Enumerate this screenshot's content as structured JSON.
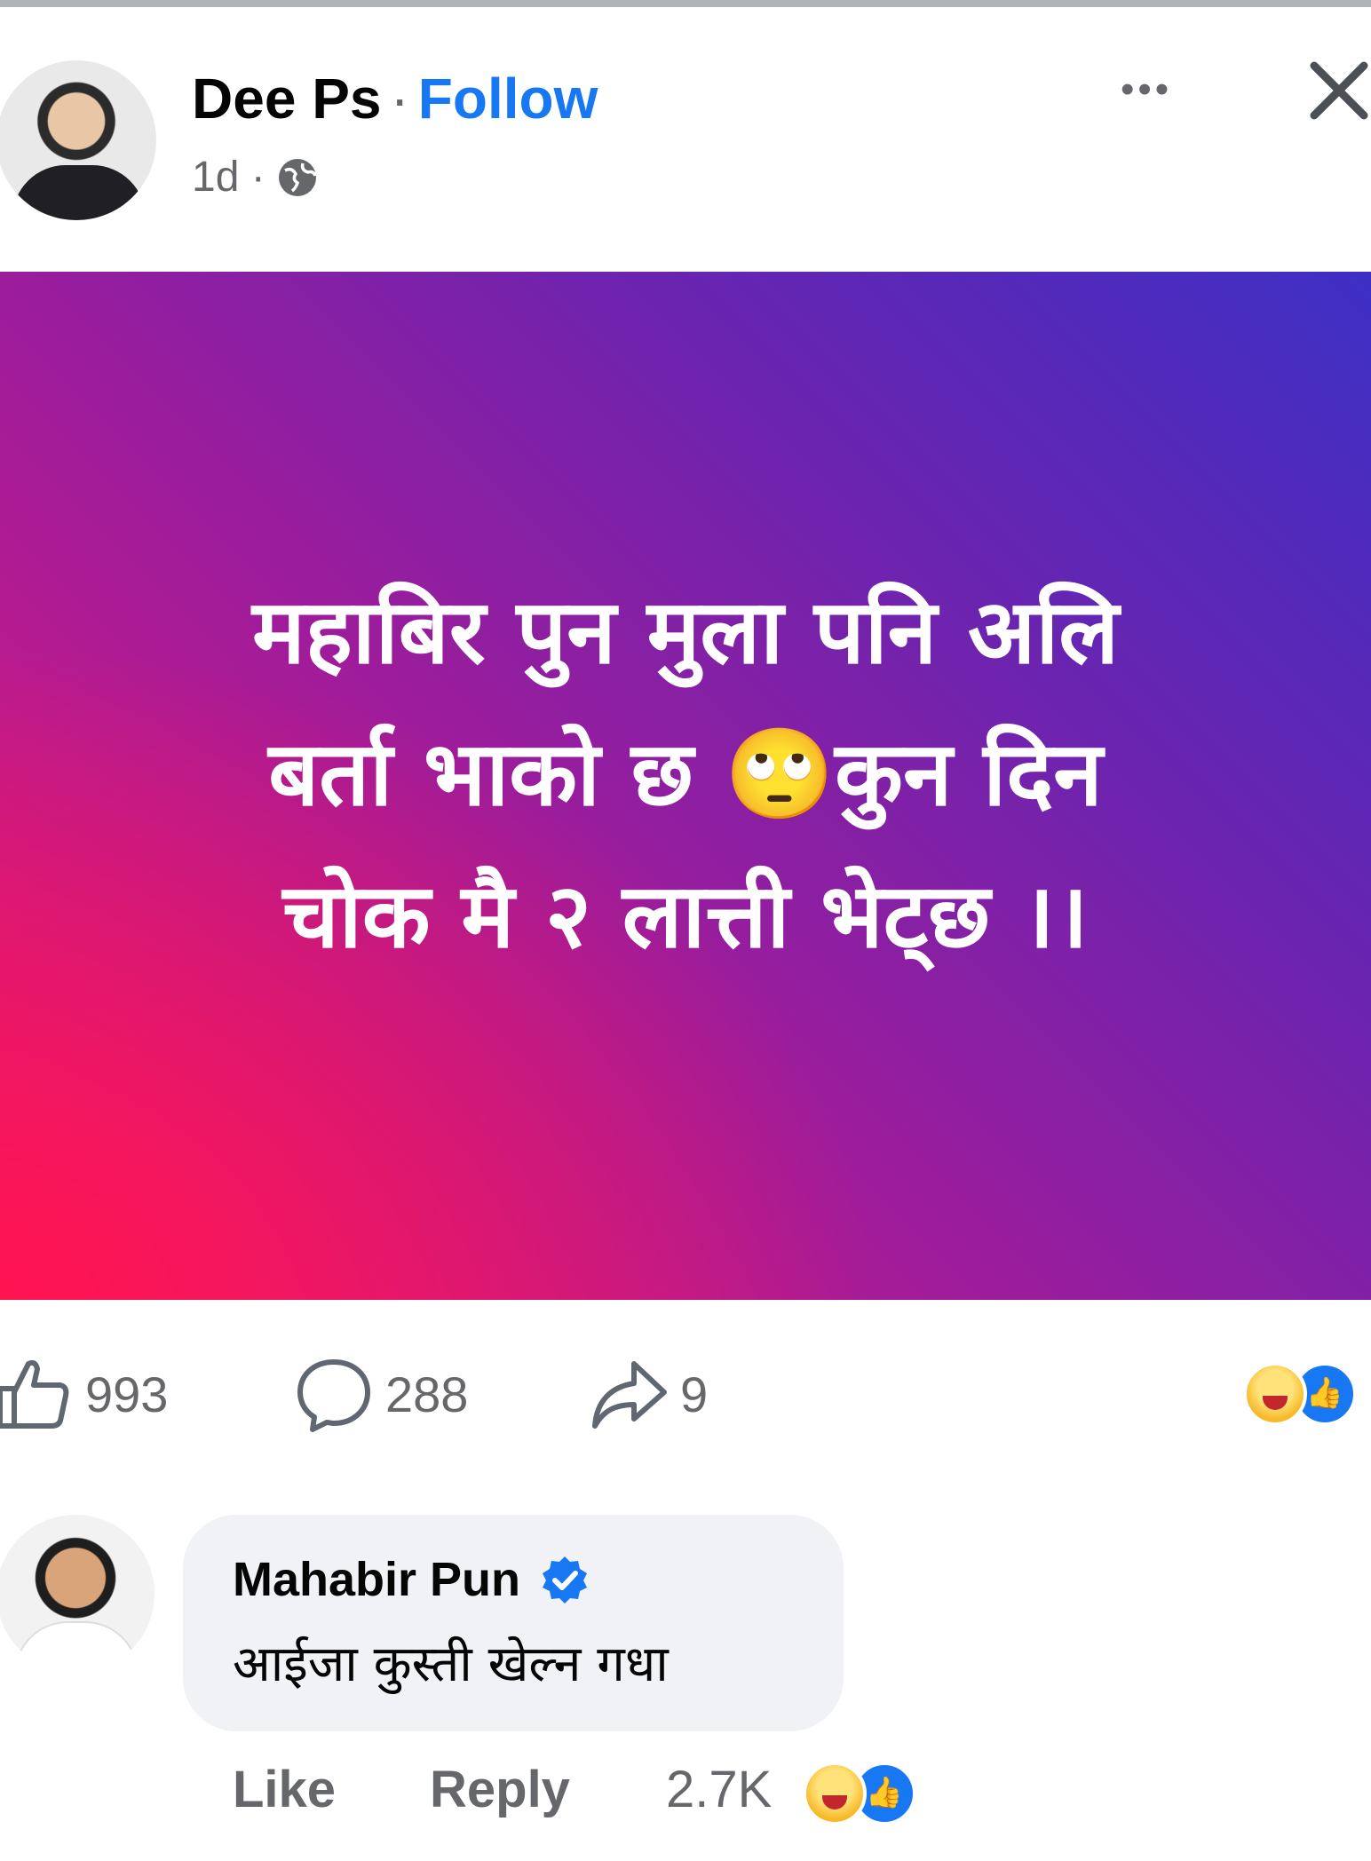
{
  "post": {
    "author": "Dee Ps",
    "separator": "·",
    "follow_label": "Follow",
    "time": "1d ·",
    "more_label": "•••",
    "text_line1": "महाबिर पुन मुला पनि अलि",
    "text_line2": "बर्ता भाको छ 🙄कुन दिन",
    "text_line3": "चोक मै २ लात्ती भेट्छ ।।",
    "gradient_colors": [
      "#ff1450",
      "#a01c9a",
      "#3d2fc4"
    ]
  },
  "stats": {
    "likes": "993",
    "comments": "288",
    "shares": "9",
    "reactions": [
      "haha-icon",
      "like-icon"
    ]
  },
  "comment": {
    "author": "Mahabir Pun",
    "verified": true,
    "text": "आईजा कुस्ती खेल्न गधा",
    "like_label": "Like",
    "reply_label": "Reply",
    "reaction_count": "2.7K",
    "reactions": [
      "haha-icon",
      "like-icon"
    ]
  },
  "colors": {
    "accent": "#1877f2",
    "muted_text": "#65676b",
    "bubble": "#f0f2f5"
  }
}
